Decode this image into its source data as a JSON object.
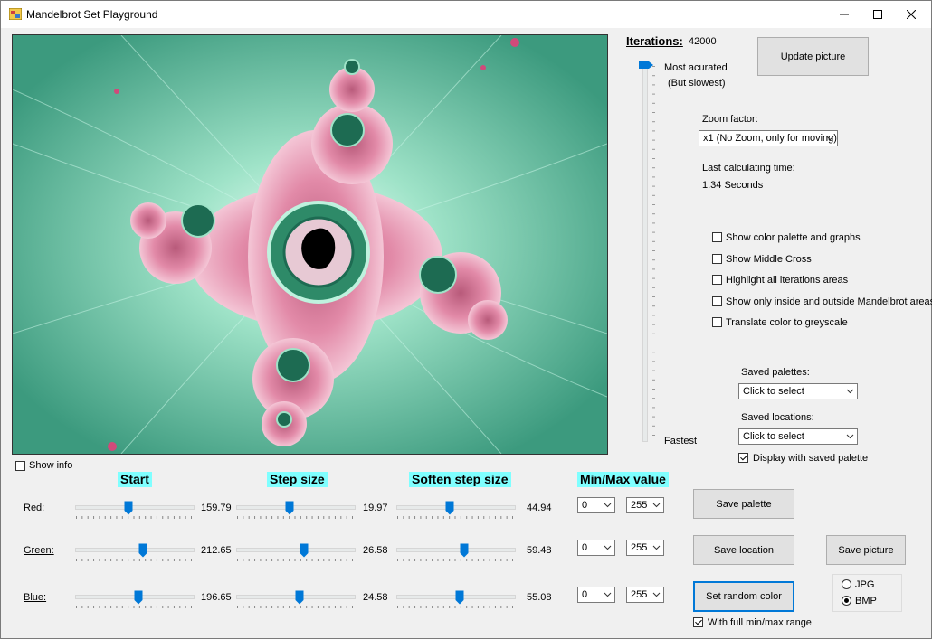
{
  "window": {
    "title": "Mandelbrot Set Playground",
    "icon": "app-icon",
    "minimize_icon": "minimize-icon",
    "maximize_icon": "maximize-icon",
    "close_icon": "close-icon"
  },
  "picture": {
    "colors": {
      "outer": "#3c9a7e",
      "glow": "#e9fff6",
      "body": "#e28aa8",
      "core": "#000000",
      "ring": "#1d6b52"
    }
  },
  "show_info": {
    "label": "Show info",
    "checked": false
  },
  "iterations": {
    "label": "Iterations:",
    "value": "42000",
    "top_label": "Most acurated",
    "top_sub_label": "(But slowest)",
    "bottom_label": "Fastest",
    "position_fraction": 0.0
  },
  "update_button": "Update picture",
  "zoom": {
    "label": "Zoom factor:",
    "selected": "x1 (No Zoom, only for moving)"
  },
  "calc_time": {
    "label": "Last calculating time:",
    "value": "1.34 Seconds"
  },
  "options": [
    {
      "label": "Show color palette and graphs",
      "checked": false
    },
    {
      "label": "Show Middle Cross",
      "checked": false
    },
    {
      "label": "Highlight all iterations areas",
      "checked": false
    },
    {
      "label": "Show only inside and outside Mandelbrot areas",
      "checked": false
    },
    {
      "label": "Translate color to greyscale",
      "checked": false
    }
  ],
  "saved_palettes": {
    "label": "Saved palettes:",
    "selected": "Click to select"
  },
  "saved_locations": {
    "label": "Saved locations:",
    "selected": "Click to select"
  },
  "display_saved_palette": {
    "label": "Display with saved palette",
    "checked": true
  },
  "headers": {
    "start": "Start",
    "step": "Step size",
    "soften": "Soften step size",
    "minmax": "Min/Max value"
  },
  "rows": [
    {
      "label": "Red:",
      "start": {
        "value": "159.79",
        "fraction": 0.45
      },
      "step": {
        "value": "19.97",
        "fraction": 0.45
      },
      "soften": {
        "value": "44.94",
        "fraction": 0.45
      },
      "min": "0",
      "max": "255"
    },
    {
      "label": "Green:",
      "start": {
        "value": "212.65",
        "fraction": 0.58
      },
      "step": {
        "value": "26.58",
        "fraction": 0.58
      },
      "soften": {
        "value": "59.48",
        "fraction": 0.58
      },
      "min": "0",
      "max": "255"
    },
    {
      "label": "Blue:",
      "start": {
        "value": "196.65",
        "fraction": 0.54
      },
      "step": {
        "value": "24.58",
        "fraction": 0.54
      },
      "soften": {
        "value": "55.08",
        "fraction": 0.54
      },
      "min": "0",
      "max": "255"
    }
  ],
  "buttons": {
    "save_palette": "Save  palette",
    "save_location": "Save location",
    "save_picture": "Save picture",
    "random_color": "Set random color"
  },
  "full_range": {
    "label": "With full min/max range",
    "checked": true
  },
  "format": [
    {
      "label": "JPG",
      "selected": false
    },
    {
      "label": "BMP",
      "selected": true
    }
  ]
}
